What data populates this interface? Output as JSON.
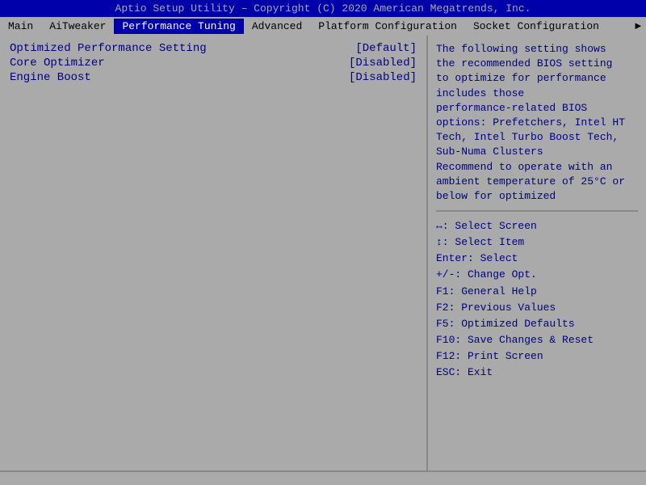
{
  "titleBar": {
    "text": "Aptio Setup Utility – Copyright (C) 2020 American Megatrends, Inc."
  },
  "menuBar": {
    "items": [
      {
        "label": "Main",
        "active": false
      },
      {
        "label": "AiTweaker",
        "active": false
      },
      {
        "label": "Performance Tuning",
        "active": true
      },
      {
        "label": "Advanced",
        "active": false
      },
      {
        "label": "Platform Configuration",
        "active": false
      },
      {
        "label": "Socket Configuration",
        "active": false
      }
    ],
    "arrowLabel": "►"
  },
  "settings": [
    {
      "label": "Optimized Performance Setting",
      "value": "[Default]",
      "selected": false
    },
    {
      "label": "Core Optimizer",
      "value": "[Disabled]",
      "selected": false
    },
    {
      "label": "Engine Boost",
      "value": "[Disabled]",
      "selected": false
    }
  ],
  "description": {
    "lines": [
      "The following setting shows",
      "the recommended BIOS setting",
      "to optimize for performance",
      "includes those",
      "performance-related BIOS",
      "options: Prefetchers, Intel HT",
      "Tech, Intel Turbo Boost Tech,",
      "Sub-Numa Clusters",
      "Recommend to operate with an",
      "ambient temperature of 25°C or",
      "below for optimized"
    ]
  },
  "help": {
    "lines": [
      "↔: Select Screen",
      "↕: Select Item",
      "Enter: Select",
      "+/-: Change Opt.",
      "F1: General Help",
      "F2: Previous Values",
      "F5: Optimized Defaults",
      "F10: Save Changes & Reset",
      "F12: Print Screen",
      "ESC: Exit"
    ]
  }
}
